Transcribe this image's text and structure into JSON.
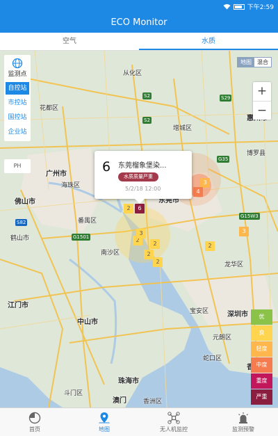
{
  "status_bar": {
    "time": "下午2:59",
    "icons": [
      "wifi-icon",
      "battery-icon"
    ]
  },
  "app": {
    "title": "ECO Monitor"
  },
  "tabs": [
    {
      "label": "空气",
      "active": false
    },
    {
      "label": "水质",
      "active": true
    }
  ],
  "side_panel": {
    "header": "监测点",
    "items": [
      {
        "label": "自控站",
        "active": true
      },
      {
        "label": "市控站",
        "active": false
      },
      {
        "label": "国控站",
        "active": false
      },
      {
        "label": "企业站",
        "active": false
      }
    ],
    "parameter": "PH"
  },
  "map_type": {
    "options": [
      "地图",
      "混合"
    ],
    "selected": "地图"
  },
  "zoom": {
    "in": "+",
    "out": "−"
  },
  "places": [
    "从化区",
    "花都区",
    "广州市",
    "海珠区",
    "佛山市",
    "番禺区",
    "南沙区",
    "江门市",
    "中山市",
    "珠海市",
    "澳门",
    "东莞市",
    "增城区",
    "惠州市",
    "龙华区",
    "深圳市",
    "宝安区",
    "元朗区",
    "香港",
    "蛇口区",
    "鹤山市",
    "斗门区",
    "香洲区",
    "博罗县"
  ],
  "road_shields": [
    "S2",
    "S2",
    "G1501",
    "S82",
    "G35",
    "G15W3",
    "S29"
  ],
  "markers": [
    "2",
    "6",
    "3",
    "4",
    "3",
    "2",
    "2",
    "2",
    "2",
    "2",
    "3"
  ],
  "popup": {
    "number": "6",
    "station_name": "东莞榴象堡染...",
    "status_badge": "水质质量严重",
    "time": "5/2/18 12:00"
  },
  "legend": [
    {
      "label": "优",
      "color": "#8bc34a"
    },
    {
      "label": "良",
      "color": "#ffd54f"
    },
    {
      "label": "轻度",
      "color": "#ffb74d"
    },
    {
      "label": "中度",
      "color": "#f57c4f"
    },
    {
      "label": "重度",
      "color": "#c2185b"
    },
    {
      "label": "严重",
      "color": "#8b1e3f"
    }
  ],
  "bottom_nav": [
    {
      "label": "首页",
      "icon": "pie-chart-icon",
      "active": false
    },
    {
      "label": "地图",
      "icon": "map-pin-icon",
      "active": true
    },
    {
      "label": "无人机监控",
      "icon": "drone-icon",
      "active": false
    },
    {
      "label": "监测预警",
      "icon": "alarm-icon",
      "active": false
    }
  ],
  "colors": {
    "primary": "#1e88e5",
    "popup_badge": "#a33a4c"
  }
}
